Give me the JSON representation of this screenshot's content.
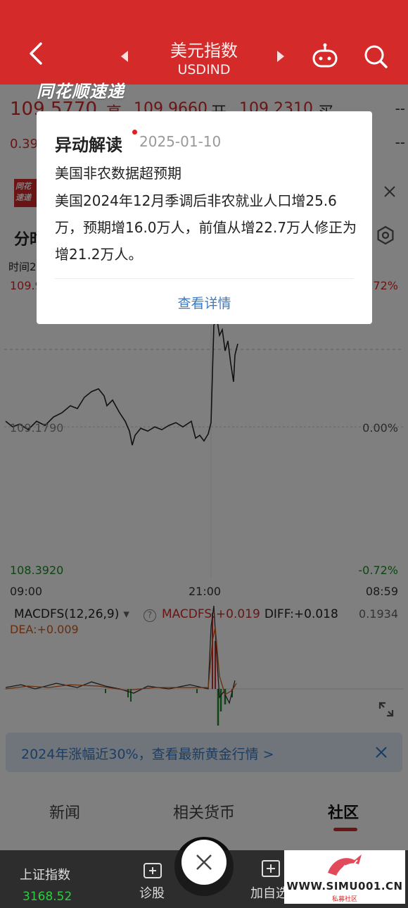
{
  "header": {
    "title": "美元指数",
    "subtitle": "USDIND",
    "watermark": "同花顺速递"
  },
  "quote": {
    "price": "109.5770",
    "high_label": "高",
    "high_value": "109.9660",
    "open_label": "开",
    "open_value": "109.2310",
    "buy_label": "买",
    "dash": "--",
    "change": "0.39"
  },
  "news_logo": "同花 速递",
  "tab_fen": "分时",
  "time_label": "时间2",
  "chart": {
    "top_left": "109.9",
    "top_right": ".72%",
    "zero_left": "109.1790",
    "zero_right": "0.00%",
    "bottom_left": "108.3920",
    "bottom_right": "-0.72%",
    "time_start": "09:00",
    "time_mid": "21:00",
    "time_end": "08:59"
  },
  "macd": {
    "name": "MACDFS(12,26,9)",
    "dropdown": "▾",
    "info": "?",
    "value": "MACDFS:+0.019",
    "diff": "DIFF:+0.018",
    "max": "0.1934",
    "dea": "DEA:+0.009"
  },
  "promo": {
    "text": "2024年涨幅近30%，查看最新黄金行情 >"
  },
  "tabs": [
    {
      "label": "新闻"
    },
    {
      "label": "相关货币"
    },
    {
      "label": "社区"
    }
  ],
  "bottom_nav": {
    "index_name": "上证指数",
    "index_value": "3168.52",
    "diagnose_label": "诊股",
    "add_label": "加自选"
  },
  "site": {
    "url": "WWW.SIMU001.CN",
    "tagline": "私募社区"
  },
  "popup": {
    "title": "异动解读",
    "date": "2025-01-10",
    "headline": "美国非农数据超预期",
    "body": "美国2024年12月季调后非农就业人口增25.6万，预期增16.0万人，前值从增22.7万人修正为增21.2万人。",
    "link": "查看详情"
  },
  "colors": {
    "brand_red": "#d42a2a",
    "up": "#d42a2a",
    "down": "#1a8a2a",
    "link_blue": "#3a7ac4"
  }
}
